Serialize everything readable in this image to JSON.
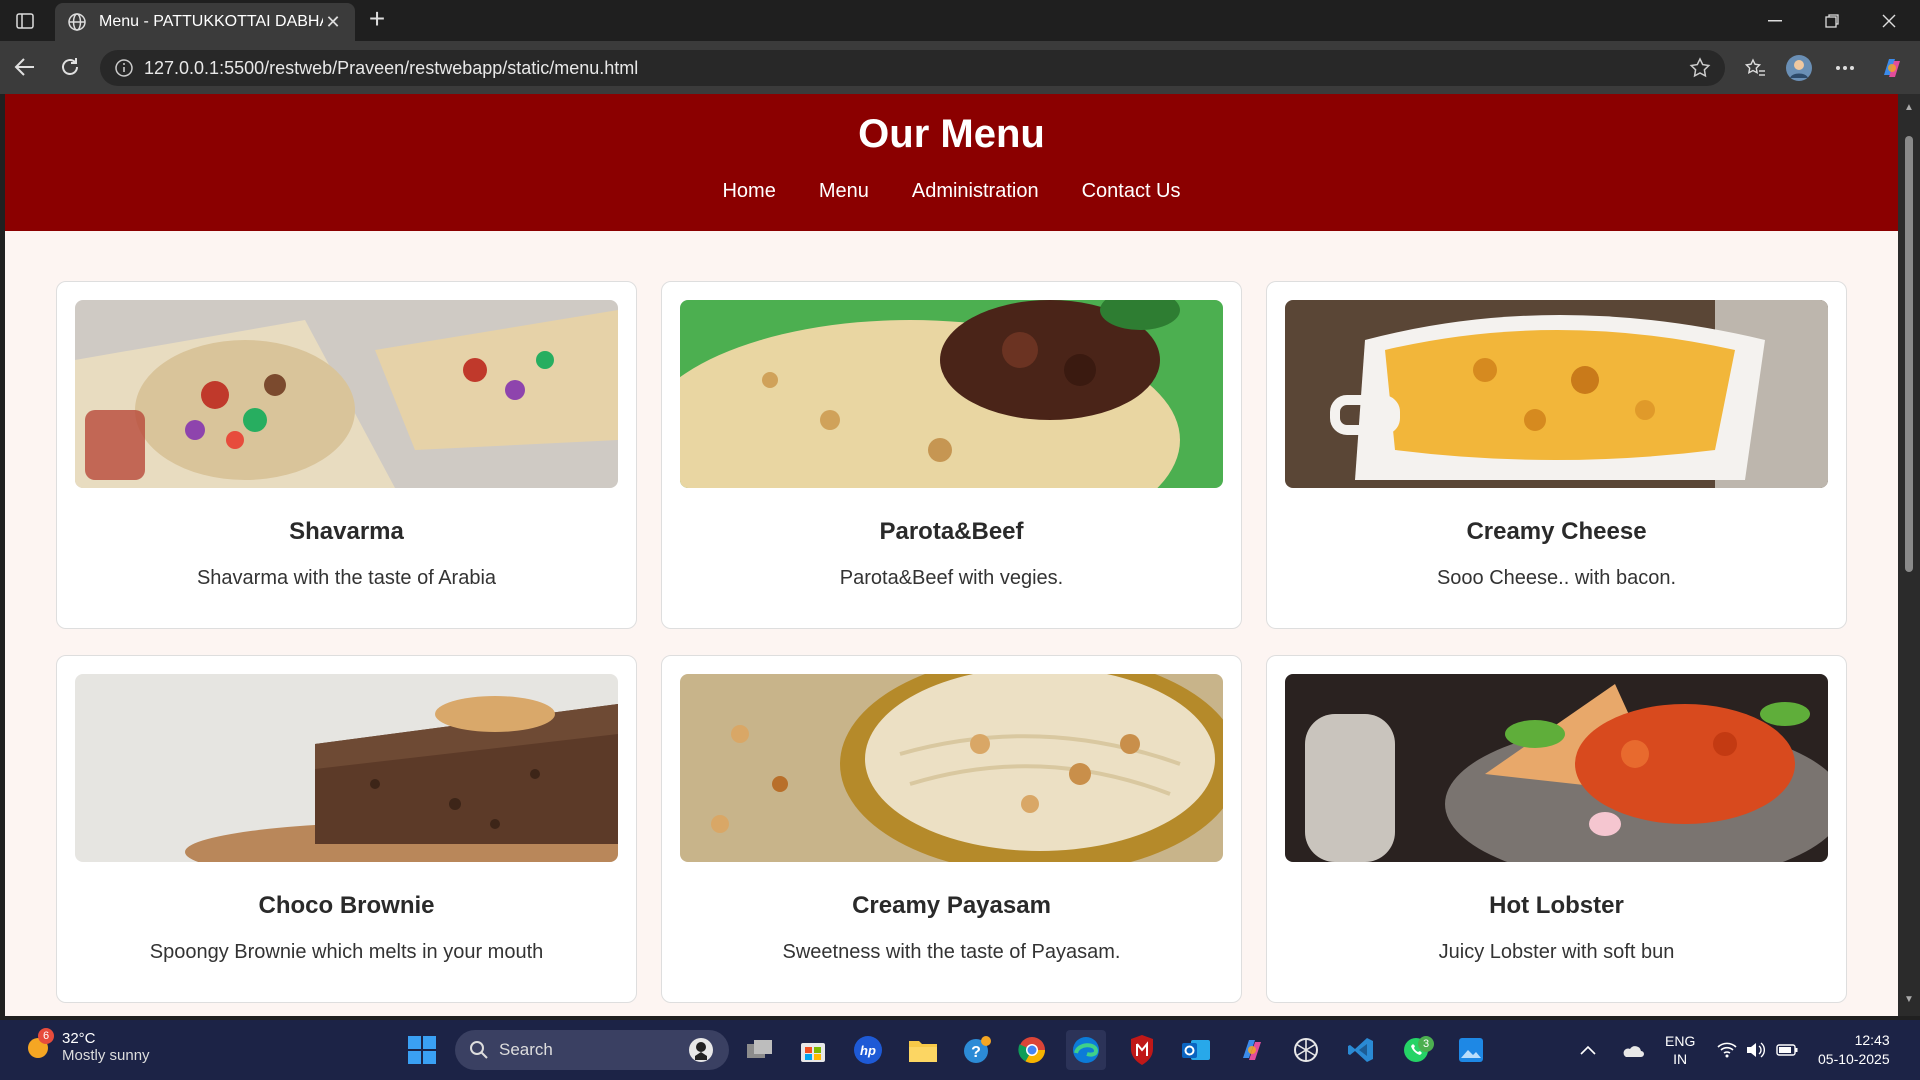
{
  "browser": {
    "tab_title": "Menu - PATTUKKOTTAI DABHA",
    "url": "127.0.0.1:5500/restweb/Praveen/restwebapp/static/menu.html"
  },
  "page": {
    "title": "Our Menu",
    "nav": [
      "Home",
      "Menu",
      "Administration",
      "Contact Us"
    ],
    "accent_color": "#8b0000",
    "items": [
      {
        "name": "Shavarma",
        "description": "Shavarma with the taste of Arabia"
      },
      {
        "name": "Parota&Beef",
        "description": "Parota&Beef with vegies."
      },
      {
        "name": "Creamy Cheese",
        "description": "Sooo Cheese.. with bacon."
      },
      {
        "name": "Choco Brownie",
        "description": "Spoongy Brownie which melts in your mouth"
      },
      {
        "name": "Creamy Payasam",
        "description": "Sweetness with the taste of Payasam."
      },
      {
        "name": "Hot Lobster",
        "description": "Juicy Lobster with soft bun"
      }
    ]
  },
  "taskbar": {
    "weather_badge": "6",
    "temperature": "32°C",
    "condition": "Mostly sunny",
    "search_placeholder": "Search",
    "whatsapp_badge": "3",
    "lang_top": "ENG",
    "lang_bottom": "IN",
    "time": "12:43",
    "date": "05-10-2025"
  }
}
